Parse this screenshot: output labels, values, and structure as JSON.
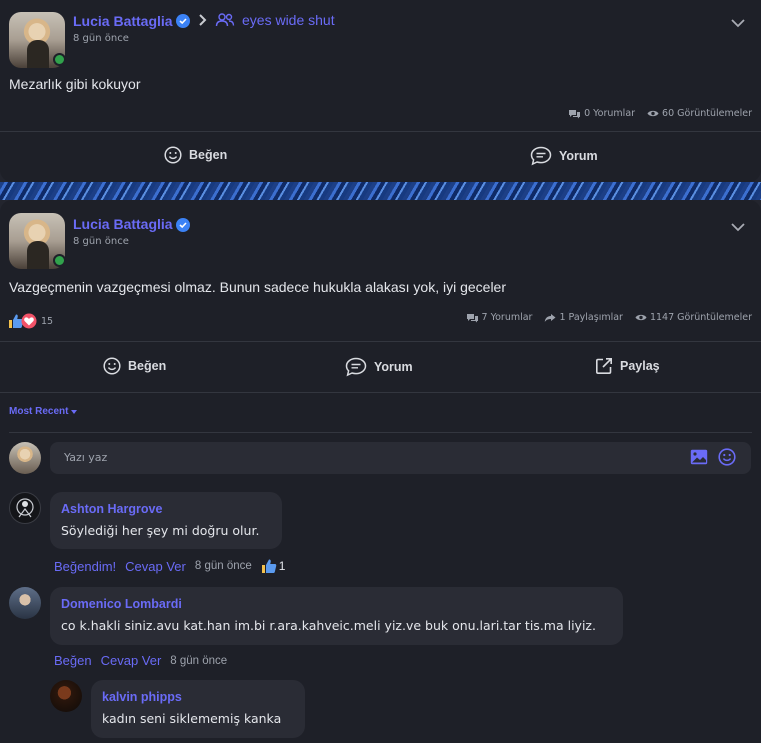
{
  "post1": {
    "author": "Lucia Battaglia",
    "group": "eyes wide shut",
    "time": "8 gün önce",
    "text": "Mezarlık gibi kokuyor",
    "comments_count": "0 Yorumlar",
    "views": "60 Görüntülemeler",
    "like_label": "Beğen",
    "comment_label": "Yorum"
  },
  "post2": {
    "author": "Lucia Battaglia",
    "time": "8 gün önce",
    "text": "Vazgeçmenin vazgeçmesi olmaz. Bunun sadece hukukla alakası yok, iyi geceler",
    "reactions_count": "15",
    "comments_count": "7 Yorumlar",
    "shares": "1 Paylaşımlar",
    "views": "1147 Görüntülemeler",
    "like_label": "Beğen",
    "comment_label": "Yorum",
    "share_label": "Paylaş"
  },
  "sort": {
    "label": "Most Recent"
  },
  "comment_input": {
    "placeholder": "Yazı yaz"
  },
  "comments": [
    {
      "author": "Ashton Hargrove",
      "text": "Söylediği her şey mi doğru olur.",
      "like_label": "Beğendim!",
      "reply_label": "Cevap Ver",
      "time": "8 gün önce",
      "reactions": "1"
    },
    {
      "author": "Domenico Lombardi",
      "text": "co k.hakli siniz.avu kat.han im.bi r.ara.kahveic.meli yiz.ve buk onu.lari.tar tis.ma liyiz.",
      "like_label": "Beğen",
      "reply_label": "Cevap Ver",
      "time": "8 gün önce"
    },
    {
      "author": "kalvin phipps",
      "text": "kadın seni siklememiş kanka"
    }
  ],
  "colors": {
    "background": "#23252e",
    "card": "#1e2028",
    "accent": "#6a6bf6",
    "verified": "#3b82f6",
    "online": "#31a24c"
  },
  "icons": [
    "verified-badge-icon",
    "chevron-right-icon",
    "group-icon",
    "chevron-down-icon",
    "comments-icon",
    "eye-icon",
    "share-arrow-icon",
    "smile-icon",
    "speech-bubble-icon",
    "external-share-icon",
    "caret-down-icon",
    "image-icon",
    "emoji-icon",
    "thumbs-up-icon",
    "heart-icon"
  ]
}
